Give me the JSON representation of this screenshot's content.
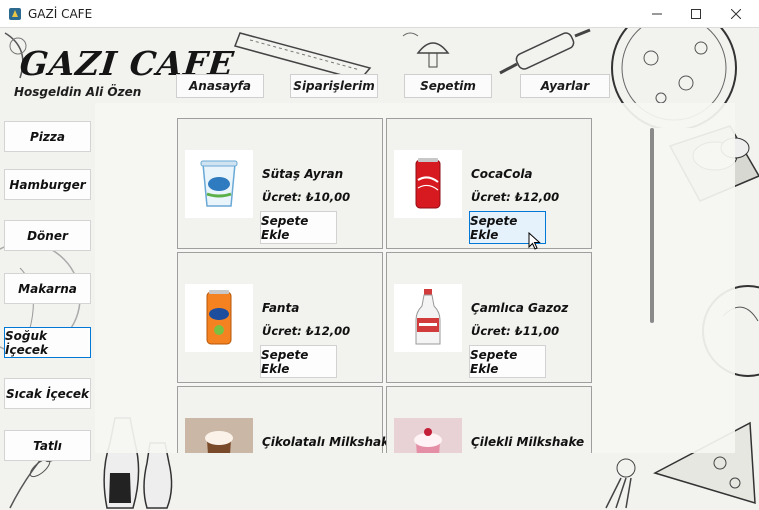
{
  "window": {
    "title": "GAZİ CAFE"
  },
  "header": {
    "brand": "GAZI CAFE",
    "welcome": "Hosgeldin Ali Özen"
  },
  "topnav": [
    {
      "label": "Anasayfa"
    },
    {
      "label": "Siparişlerim"
    },
    {
      "label": "Sepetim"
    },
    {
      "label": "Ayarlar"
    }
  ],
  "categories": [
    {
      "label": "Pizza"
    },
    {
      "label": "Hamburger"
    },
    {
      "label": "Döner"
    },
    {
      "label": "Makarna"
    },
    {
      "label": "Soğuk İçecek",
      "active": true
    },
    {
      "label": "Sıcak İçecek"
    },
    {
      "label": "Tatlı"
    }
  ],
  "products": [
    {
      "name": "Sütaş Ayran",
      "price": "Ücret: ₺10,00",
      "button": "Sepete Ekle",
      "icon": "ayran-cup"
    },
    {
      "name": "CocaCola",
      "price": "Ücret: ₺12,00",
      "button": "Sepete Ekle",
      "icon": "cola-can"
    },
    {
      "name": "Fanta",
      "price": "Ücret: ₺12,00",
      "button": "Sepete Ekle",
      "icon": "fanta-can"
    },
    {
      "name": "Çamlıca Gazoz",
      "price": "Ücret: ₺11,00",
      "button": "Sepete Ekle",
      "icon": "gazoz-bottle"
    },
    {
      "name": "Çikolatalı Milkshake",
      "price": "",
      "button": "",
      "icon": "chocolate-milkshake"
    },
    {
      "name": "Çilekli Milkshake",
      "price": "",
      "button": "",
      "icon": "strawberry-milkshake"
    }
  ],
  "colors": {
    "accent": "#0078d7",
    "hover_bg": "#e5f1fb",
    "card_border": "#9f9f9f"
  }
}
